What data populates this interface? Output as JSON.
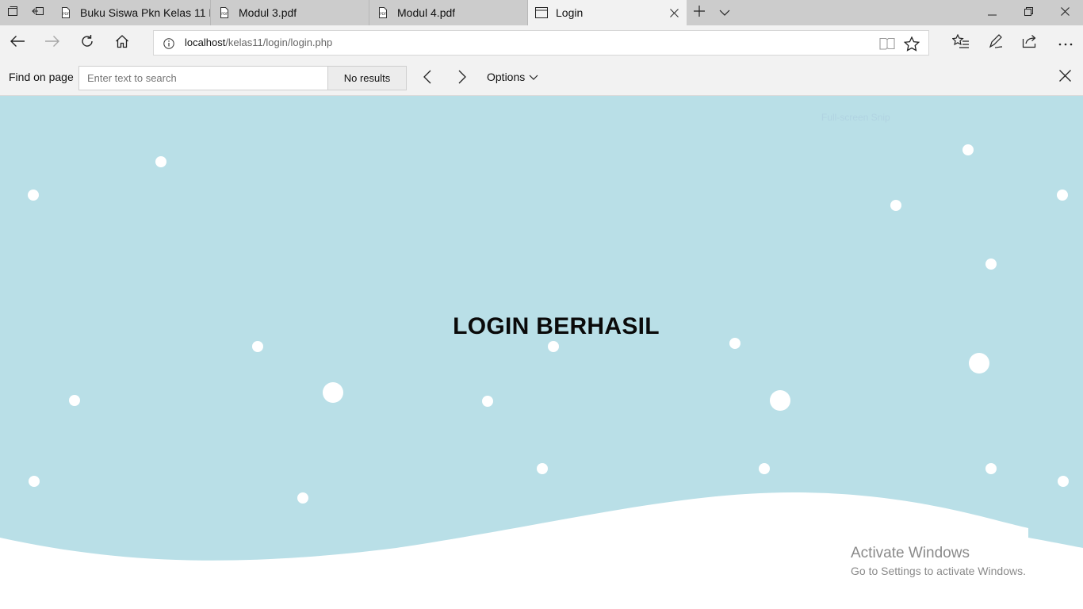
{
  "browser": {
    "tabs": [
      {
        "label": "Buku Siswa Pkn Kelas 11 Re",
        "icon": "pdf-icon"
      },
      {
        "label": "Modul 3.pdf",
        "icon": "pdf-icon"
      },
      {
        "label": "Modul 4.pdf",
        "icon": "pdf-icon"
      },
      {
        "label": "Login",
        "icon": "page-icon"
      }
    ],
    "url_host": "localhost",
    "url_path": "/kelas11/login/login.php"
  },
  "find_bar": {
    "label": "Find on page",
    "placeholder": "Enter text to search",
    "results": "No results",
    "options_label": "Options"
  },
  "page": {
    "heading": "LOGIN BERHASIL",
    "background_color": "#b9dfe7",
    "snip_hint": "Full-screen Snip"
  },
  "watermark": {
    "title": "Activate Windows",
    "subtitle": "Go to Settings to activate Windows."
  }
}
